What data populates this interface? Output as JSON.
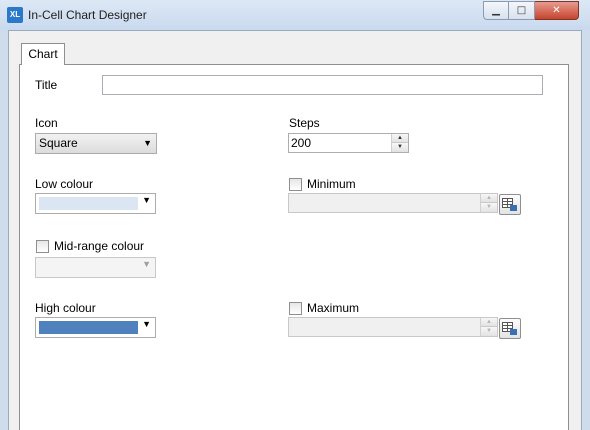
{
  "window": {
    "title": "In-Cell Chart Designer",
    "icon_text": "XL",
    "controls": {
      "minimize": "▁",
      "maximize": "□",
      "close": "✕"
    }
  },
  "tabs": [
    {
      "label": "Chart",
      "selected": true
    }
  ],
  "form": {
    "title_label": "Title",
    "title_value": "",
    "icon_label": "Icon",
    "icon_value": "Square",
    "steps_label": "Steps",
    "steps_value": "200",
    "low_colour_label": "Low colour",
    "low_colour": "#dce6f3",
    "minimum_label": "Minimum",
    "minimum_checked": false,
    "minimum_value": "",
    "mid_colour_label": "Mid-range colour",
    "mid_colour_checked": false,
    "mid_colour": "#f4f4f4",
    "high_colour_label": "High colour",
    "high_colour": "#4f81bd",
    "maximum_label": "Maximum",
    "maximum_checked": false,
    "maximum_value": ""
  },
  "icons": {
    "dropdown": "▼",
    "spin_up": "▲",
    "spin_down": "▼",
    "cell_picker": "range-select-icon"
  }
}
